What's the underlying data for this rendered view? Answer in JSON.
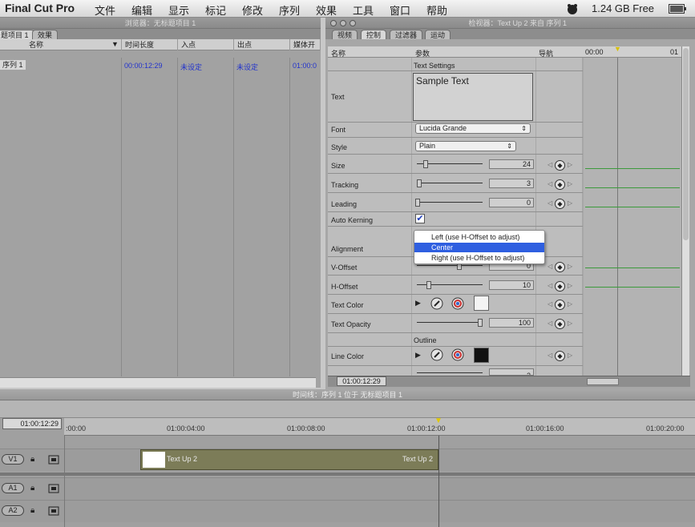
{
  "menubar": {
    "app": "Final Cut Pro",
    "items": [
      "文件",
      "编辑",
      "显示",
      "标记",
      "修改",
      "序列",
      "效果",
      "工具",
      "窗口",
      "帮助"
    ],
    "memory": "1.24 GB Free"
  },
  "browser": {
    "title": "浏览器：无标题项目 1",
    "tabs": [
      "题项目 1",
      "效果"
    ],
    "columns": [
      "名称",
      "时间长度",
      "入点",
      "出点",
      "媒体开"
    ],
    "row": {
      "name": "序列 1",
      "duration": "00:00:12:29",
      "in": "未设定",
      "out": "未设定",
      "media": "01:00:0"
    }
  },
  "viewer": {
    "title": "检视器：Text Up 2 来自 序列 1",
    "tabs": [
      "视频",
      "控制",
      "过滤器",
      "运动"
    ],
    "col_headers": {
      "name": "名称",
      "params": "参数",
      "nav": "导航"
    },
    "ruler_start": "00:00",
    "ruler_next": "01",
    "section_text": "Text Settings",
    "text_value": "Sample Text",
    "section_outline": "Outline",
    "params": {
      "text": "Text",
      "font": "Font",
      "font_value": "Lucida Grande",
      "style": "Style",
      "style_value": "Plain",
      "size": "Size",
      "size_value": "24",
      "tracking": "Tracking",
      "tracking_value": "3",
      "leading": "Leading",
      "leading_value": "0",
      "auto_kerning": "Auto Kerning",
      "alignment": "Alignment",
      "v_offset": "V-Offset",
      "v_offset_value": "0",
      "h_offset": "H-Offset",
      "h_offset_value": "10",
      "text_color": "Text Color",
      "text_opacity": "Text Opacity",
      "text_opacity_value": "100",
      "line_color": "Line Color",
      "line_width_value": "2"
    },
    "timecode": "01:00:12:29",
    "alignment_menu": [
      "Left (use H-Offset to adjust)",
      "Center",
      "Right (use H-Offset to adjust)"
    ]
  },
  "timeline": {
    "title": "时间线：序列 1 位于 无标题项目 1",
    "current_tc": "01:00:12:29",
    "ruler": [
      ":00:00",
      "01:00:04:00",
      "01:00:08:00",
      "01:00:12:00",
      "01:00:16:00",
      "01:00:20:00"
    ],
    "tracks": [
      "V1",
      "A1",
      "A2"
    ],
    "clip_start_label": "Text Up 2",
    "clip_end_label": "Text Up 2"
  },
  "colors": {
    "selection": "#2f5fe0",
    "keyframe_line": "#3c9a3c",
    "clip": "#7c7c58"
  }
}
